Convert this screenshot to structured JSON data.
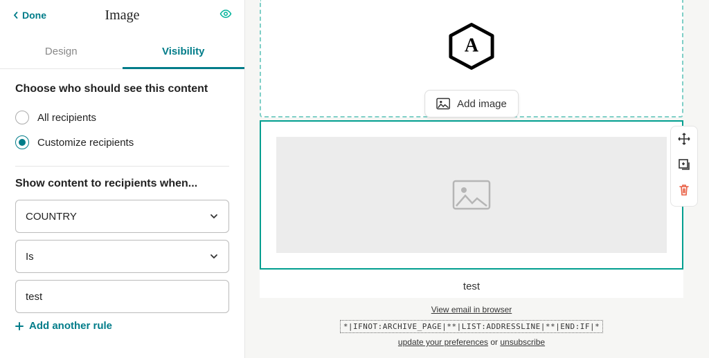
{
  "sidebar": {
    "done": "Done",
    "title": "Image",
    "tabs": {
      "design": "Design",
      "visibility": "Visibility"
    },
    "section_who": "Choose who should see this content",
    "radio_all": "All recipients",
    "radio_custom": "Customize recipients",
    "section_rule": "Show content to recipients when...",
    "field_select": "COUNTRY",
    "op_select": "Is",
    "value_input": "test",
    "add_rule": "Add another rule"
  },
  "canvas": {
    "hex_letter": "A",
    "add_image": "Add image",
    "caption": "test",
    "view_browser": "View email in browser",
    "merge": "*|IFNOT:ARCHIVE_PAGE|**|LIST:ADDRESSLINE|**|END:IF|*",
    "update_pref": "update your preferences",
    "or": " or ",
    "unsubscribe": "unsubscribe"
  }
}
